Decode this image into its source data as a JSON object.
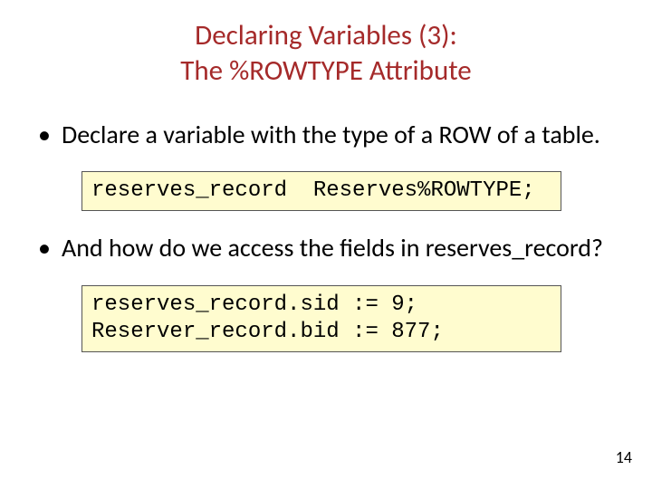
{
  "title_line1": "Declaring Variables (3):",
  "title_line2": "The %ROWTYPE Attribute",
  "bullet1": "Declare a variable with the type of a ROW of a table.",
  "code1": "reserves_record  Reserves%ROWTYPE;",
  "bullet2": "And how do we access the fields in reserves_record?",
  "code2": "reserves_record.sid := 9;\nReserver_record.bid := 877;",
  "page_number": "14"
}
